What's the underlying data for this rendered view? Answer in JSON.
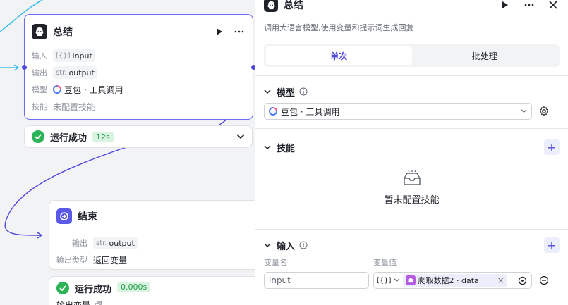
{
  "canvas": {
    "summary_node": {
      "title": "总结",
      "rows": {
        "input_label": "输入",
        "input_type": "[{}]",
        "input_value": "input",
        "output_label": "输出",
        "output_type": "str.",
        "output_value": "output",
        "model_label": "模型",
        "model_value": "豆包 · 工具调用",
        "skill_label": "技能",
        "skill_value": "未配置技能"
      }
    },
    "summary_status": {
      "text": "运行成功",
      "time": "12s"
    },
    "end_node": {
      "title": "结束",
      "rows": {
        "output_label": "输出",
        "output_type": "str.",
        "output_value": "output",
        "output_type_label": "输出类型",
        "output_type_value": "返回变量"
      }
    },
    "end_status": {
      "text": "运行成功",
      "time": "0.000s",
      "partial_label": "输出变量"
    }
  },
  "panel": {
    "title": "总结",
    "description": "调用大语言模型,使用变量和提示词生成回复",
    "tabs": [
      {
        "label": "单次",
        "active": true
      },
      {
        "label": "批处理",
        "active": false
      }
    ],
    "model": {
      "title": "模型",
      "selected": "豆包 · 工具调用"
    },
    "skills": {
      "title": "技能",
      "empty_text": "暂未配置技能"
    },
    "inputs": {
      "title": "输入",
      "col_name": "变量名",
      "col_value": "变量值",
      "row": {
        "name": "input",
        "type_glyph": "[{}]",
        "ref_label": "爬取数据2 · data"
      }
    }
  },
  "colors": {
    "accent": "#4e49db",
    "success": "#2cb357",
    "edge": "#4e49db",
    "edge_cyan": "#22b5e8"
  }
}
